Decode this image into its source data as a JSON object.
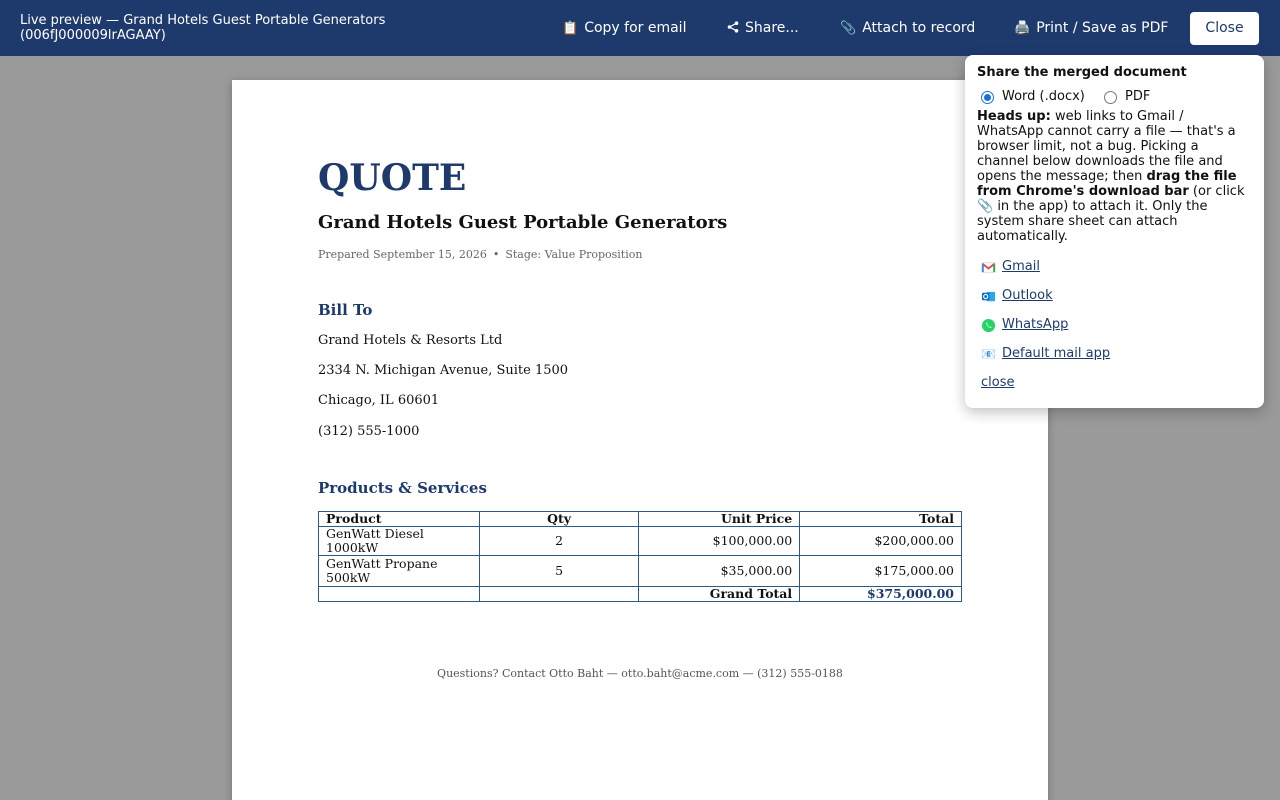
{
  "topbar": {
    "title": "Live preview — Grand Hotels Guest Portable Generators (006fJ000009lrAGAAY)",
    "copy_label": "Copy for email",
    "share_label": "Share...",
    "attach_label": "Attach to record",
    "print_label": "Print / Save as PDF",
    "close_label": "Close",
    "icons": {
      "copy": "clipboard-icon",
      "share": "share-icon",
      "attach": "paperclip-icon",
      "print": "printer-icon"
    }
  },
  "document": {
    "title": "QUOTE",
    "subtitle": "Grand Hotels Guest Portable Generators",
    "prepared": "Prepared September 15, 2026",
    "separator": "•",
    "stage": "Stage: Value Proposition",
    "bill_to_heading": "Bill To",
    "bill_to": {
      "company": "Grand Hotels & Resorts Ltd",
      "street": "2334 N. Michigan Avenue, Suite 1500",
      "city": "Chicago, IL 60601",
      "phone": "(312) 555-1000"
    },
    "products_heading": "Products & Services",
    "table": {
      "headers": [
        "Product",
        "Qty",
        "Unit Price",
        "Total"
      ],
      "rows": [
        {
          "product": "GenWatt Diesel 1000kW",
          "qty": "2",
          "unit_price": "$100,000.00",
          "total": "$200,000.00"
        },
        {
          "product": "GenWatt Propane 500kW",
          "qty": "5",
          "unit_price": "$35,000.00",
          "total": "$175,000.00"
        }
      ],
      "grand_total_label": "Grand Total",
      "grand_total": "$375,000.00"
    },
    "footer": "Questions? Contact Otto Baht — otto.baht@acme.com — (312) 555-0188"
  },
  "share_popover": {
    "heading": "Share the merged document",
    "format_word": "Word (.docx)",
    "format_pdf": "PDF",
    "selected_format": "word",
    "notice_bold1": "Heads up:",
    "notice_text1": " web links to Gmail / WhatsApp cannot carry a file — that's a browser limit, not a bug. Picking a channel below downloads the file and opens the message; then ",
    "notice_bold2": "drag the file from Chrome's download bar",
    "notice_text2": " (or click 📎 in the app) to attach it. Only the system share sheet can attach automatically.",
    "channels": {
      "gmail": "Gmail",
      "outlook": "Outlook",
      "whatsapp": "WhatsApp",
      "mail": "Default mail app"
    },
    "close_label": "close"
  },
  "colors": {
    "topbar": "#1e3a6d",
    "accent": "#1e3a6d",
    "radio": "#1a6fe0",
    "gmail_red": "#ea4335",
    "outlook_blue": "#0f6cbd",
    "whatsapp_green": "#25d366"
  }
}
